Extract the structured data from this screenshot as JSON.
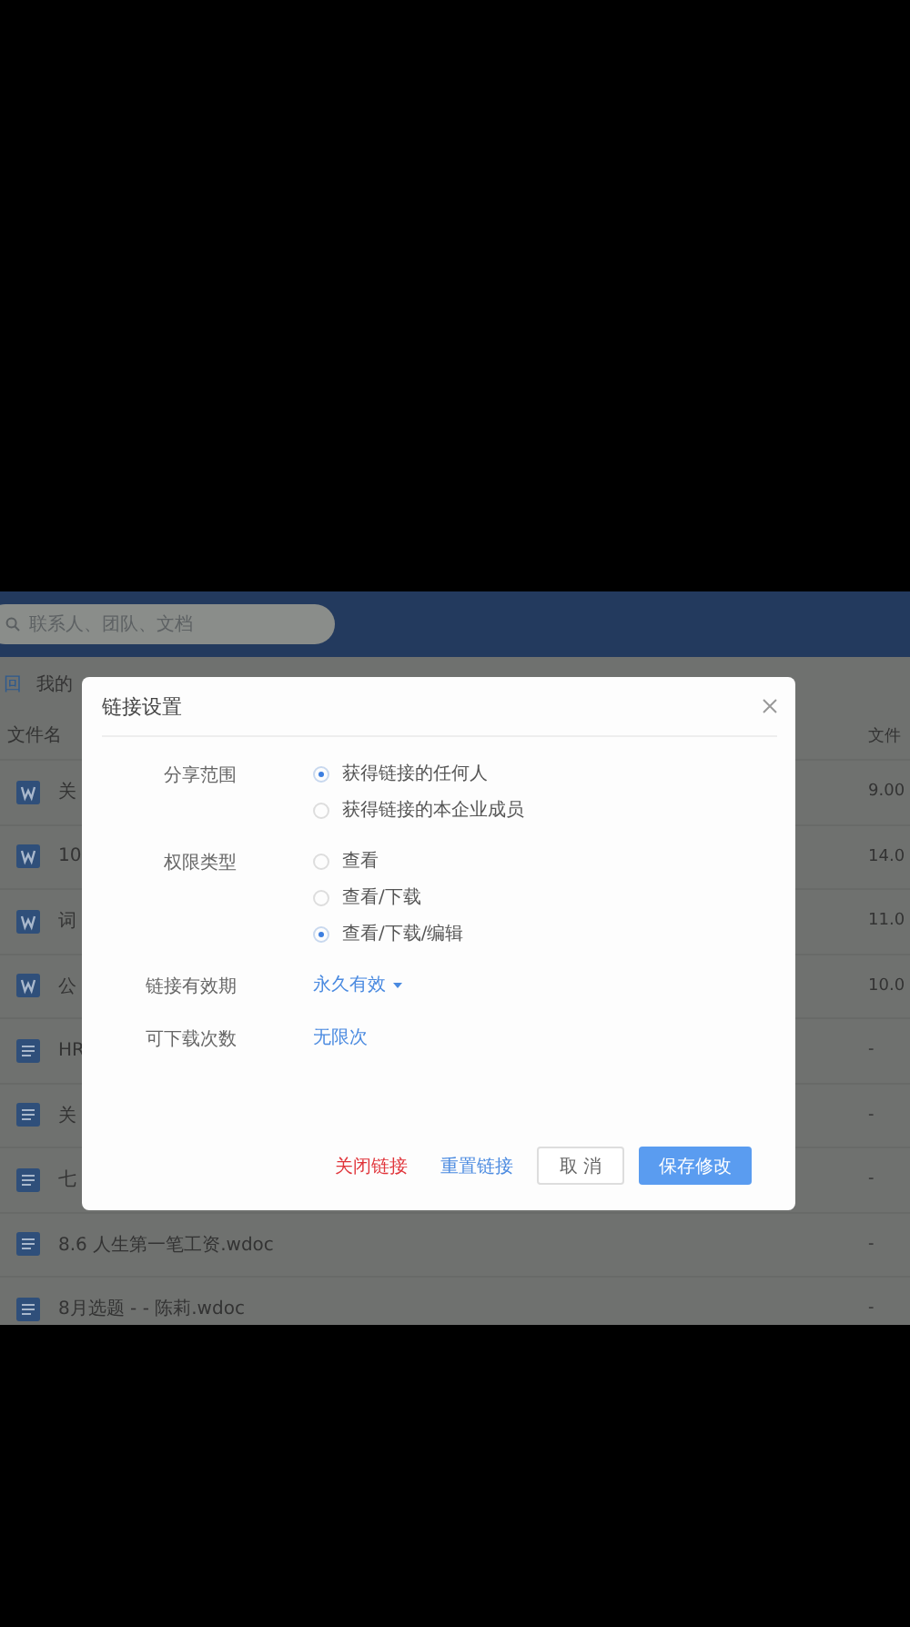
{
  "header": {
    "search": {
      "placeholder": "联系人、团队、文档"
    }
  },
  "breadcrumb": {
    "back": "回",
    "current": "我的"
  },
  "table": {
    "columns": [
      "文件名",
      "文件"
    ],
    "rows": [
      {
        "name": "关",
        "kind": "wfile",
        "column_2": "9.00"
      },
      {
        "name": "10",
        "kind": "wfile",
        "column_2": "14.0"
      },
      {
        "name": "词",
        "kind": "wfile",
        "column_2": "11.0"
      },
      {
        "name": "公",
        "kind": "wfile",
        "column_2": "10.0"
      },
      {
        "name": "HR",
        "kind": "doc",
        "column_2": "-"
      },
      {
        "name": "关",
        "kind": "doc",
        "column_2": "-"
      },
      {
        "name": "七",
        "kind": "doc",
        "column_2": "-"
      },
      {
        "name": "8.6 人生第一笔工资.wdoc",
        "kind": "doc",
        "column_2": "-"
      },
      {
        "name": "8月选题 - - 陈莉.wdoc",
        "kind": "doc",
        "column_2": "-"
      }
    ]
  },
  "dialog": {
    "title": "链接设置",
    "fields": [
      {
        "label": "分享范围",
        "kind": "radio",
        "options": [
          {
            "label": "获得链接的任何人",
            "selected": true
          },
          {
            "label": "获得链接的本企业成员",
            "selected": false
          }
        ]
      },
      {
        "label": "权限类型",
        "kind": "radio",
        "options": [
          {
            "label": "查看",
            "selected": false
          },
          {
            "label": "查看/下载",
            "selected": false
          },
          {
            "label": "查看/下载/编辑",
            "selected": true
          }
        ]
      },
      {
        "label": "链接有效期",
        "kind": "dropdown",
        "value": "永久有效"
      },
      {
        "label": "可下载次数",
        "kind": "link",
        "value": "无限次"
      }
    ],
    "actions": [
      {
        "label": "关闭链接",
        "kind": "danger"
      },
      {
        "label": "重置链接",
        "kind": "link"
      },
      {
        "label": "取 消",
        "kind": "secondary"
      },
      {
        "label": "保存修改",
        "kind": "primary"
      }
    ]
  }
}
